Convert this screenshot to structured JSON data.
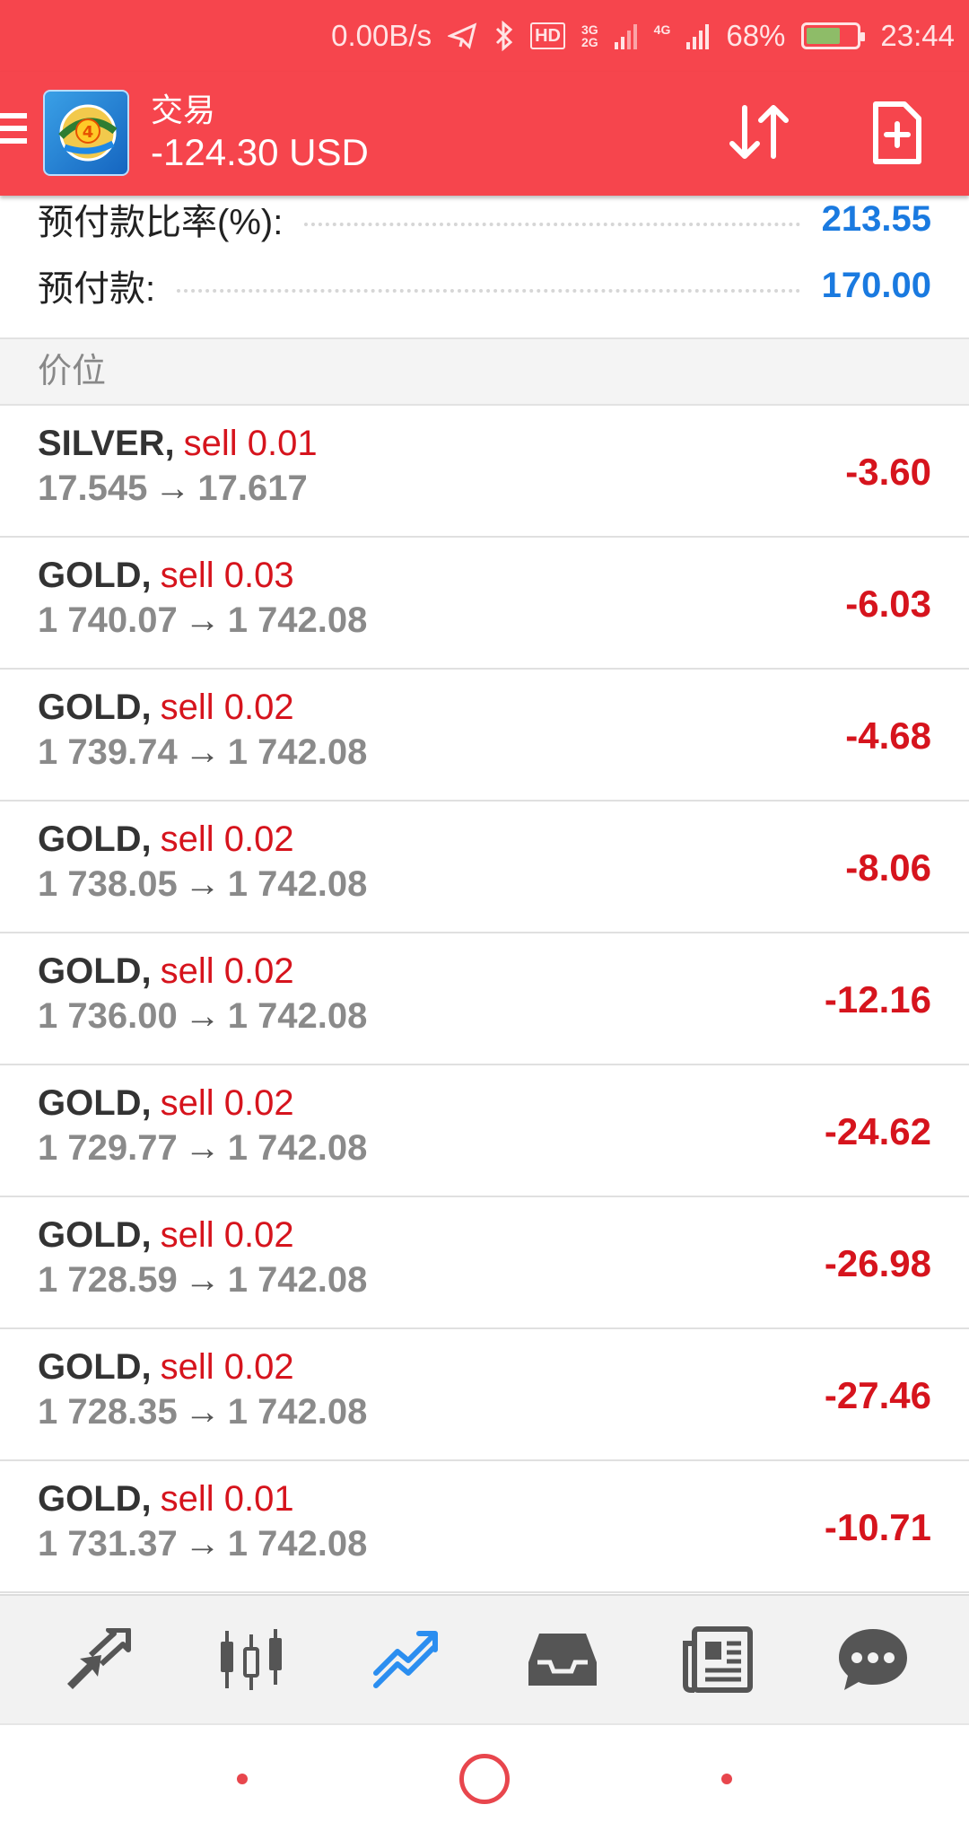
{
  "status_bar": {
    "speed": "0.00B/s",
    "hd": "HD",
    "net_top": "3G",
    "net_bottom": "2G",
    "net2": "4G",
    "battery": "68%",
    "battery_level": 0.68,
    "time": "23:44",
    "icons": [
      "mute-icon",
      "bluetooth-icon",
      "signal-icon",
      "battery-icon"
    ]
  },
  "app_bar": {
    "title": "交易",
    "subtitle": "-124.30 USD",
    "icons": [
      "menu-icon",
      "app-logo",
      "sort-icon",
      "new-order-icon"
    ]
  },
  "summary": [
    {
      "label": "预付款比率(%):",
      "value": "213.55"
    },
    {
      "label": "预付款:",
      "value": "170.00"
    }
  ],
  "section_header": "价位",
  "positions": [
    {
      "symbol": "SILVER",
      "type": "sell 0.01",
      "open": "17.545",
      "current": "17.617",
      "profit": "-3.60"
    },
    {
      "symbol": "GOLD",
      "type": "sell 0.03",
      "open": "1 740.07",
      "current": "1 742.08",
      "profit": "-6.03"
    },
    {
      "symbol": "GOLD",
      "type": "sell 0.02",
      "open": "1 739.74",
      "current": "1 742.08",
      "profit": "-4.68"
    },
    {
      "symbol": "GOLD",
      "type": "sell 0.02",
      "open": "1 738.05",
      "current": "1 742.08",
      "profit": "-8.06"
    },
    {
      "symbol": "GOLD",
      "type": "sell 0.02",
      "open": "1 736.00",
      "current": "1 742.08",
      "profit": "-12.16"
    },
    {
      "symbol": "GOLD",
      "type": "sell 0.02",
      "open": "1 729.77",
      "current": "1 742.08",
      "profit": "-24.62"
    },
    {
      "symbol": "GOLD",
      "type": "sell 0.02",
      "open": "1 728.59",
      "current": "1 742.08",
      "profit": "-26.98"
    },
    {
      "symbol": "GOLD",
      "type": "sell 0.02",
      "open": "1 728.35",
      "current": "1 742.08",
      "profit": "-27.46"
    },
    {
      "symbol": "GOLD",
      "type": "sell 0.01",
      "open": "1 731.37",
      "current": "1 742.08",
      "profit": "-10.71"
    }
  ],
  "tabs": [
    {
      "icon": "quotes-icon",
      "active": false
    },
    {
      "icon": "chart-icon",
      "active": false
    },
    {
      "icon": "trade-icon",
      "active": true
    },
    {
      "icon": "history-icon",
      "active": false
    },
    {
      "icon": "news-icon",
      "active": false
    },
    {
      "icon": "chat-icon",
      "active": false
    }
  ],
  "colors": {
    "header": "#f6454d",
    "loss": "#d6141d",
    "value_blue": "#1a7ae0",
    "tab_icon": "#555555",
    "tab_active": "#2b8ef0"
  }
}
